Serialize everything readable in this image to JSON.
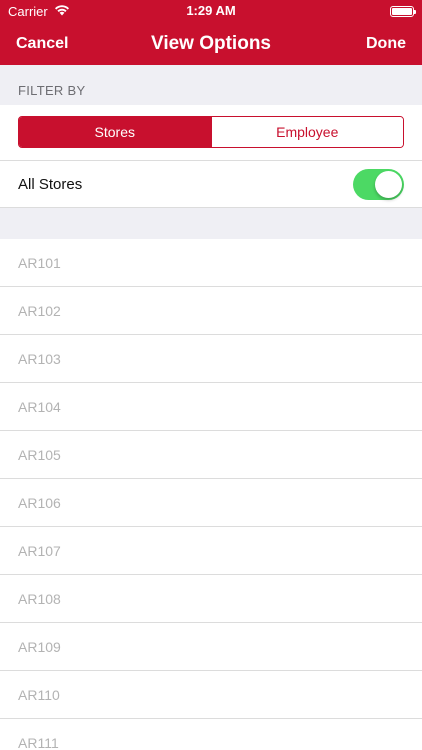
{
  "status_bar": {
    "carrier": "Carrier",
    "time": "1:29 AM"
  },
  "nav": {
    "cancel_label": "Cancel",
    "title": "View Options",
    "done_label": "Done"
  },
  "filter": {
    "section_label": "FILTER BY",
    "segments": [
      {
        "label": "Stores",
        "selected": true
      },
      {
        "label": "Employee",
        "selected": false
      }
    ],
    "all_stores_label": "All Stores",
    "all_stores_enabled": true
  },
  "stores": [
    {
      "label": "AR101"
    },
    {
      "label": "AR102"
    },
    {
      "label": "AR103"
    },
    {
      "label": "AR104"
    },
    {
      "label": "AR105"
    },
    {
      "label": "AR106"
    },
    {
      "label": "AR107"
    },
    {
      "label": "AR108"
    },
    {
      "label": "AR109"
    },
    {
      "label": "AR110"
    },
    {
      "label": "AR111"
    }
  ],
  "colors": {
    "brand": "#c8102e",
    "toggle_on": "#4cd964",
    "disabled_text": "#b3b3b3"
  }
}
